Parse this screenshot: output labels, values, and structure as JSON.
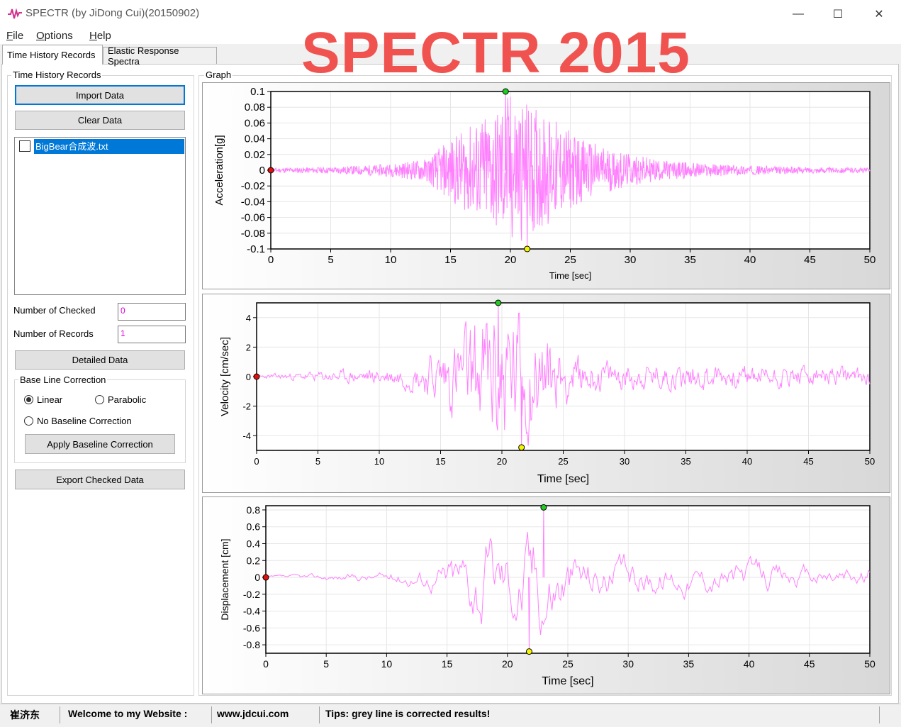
{
  "window": {
    "title": "SPECTR (by JiDong Cui)(20150902)",
    "overlay_title": "SPECTR 2015",
    "minimize_label": "—",
    "maximize_label": "☐",
    "close_label": "✕"
  },
  "menu": [
    {
      "accel": "F",
      "rest": "ile"
    },
    {
      "accel": "O",
      "rest": "ptions"
    },
    {
      "accel": "H",
      "rest": "elp"
    }
  ],
  "tabs": [
    {
      "label": "Time History Records",
      "active": true
    },
    {
      "label": "Elastic Response Spectra",
      "active": false
    }
  ],
  "left_panel": {
    "group_title": "Time History Records",
    "import_button": "Import Data",
    "clear_button": "Clear Data",
    "records": [
      {
        "name": "BigBear合成波.txt",
        "checked": false,
        "selected": true
      }
    ],
    "checked_label": "Number of Checked",
    "checked_value": "0",
    "records_label": "Number of Records",
    "records_value": "1",
    "detailed_button": "Detailed Data",
    "baseline": {
      "group_title": "Base Line Correction",
      "linear_label": "Linear",
      "parabolic_label": "Parabolic",
      "none_label": "No Baseline Correction",
      "selected": "linear",
      "apply_button": "Apply Baseline Correction"
    },
    "export_button": "Export Checked Data"
  },
  "graph_group_title": "Graph",
  "status": {
    "author": "崔济东",
    "welcome": "Welcome to my Website :",
    "website": "www.jdcui.com",
    "tips": "Tips: grey line is corrected results!"
  },
  "colors": {
    "trace": "#ff80ff",
    "max_marker": "#22cc22",
    "min_marker": "#f5f500",
    "start_marker": "#e01010",
    "tick_label": "#000000",
    "number_text": "#e000e0"
  },
  "chart_data": [
    {
      "type": "line",
      "title": "",
      "xlabel": "Time [sec]",
      "ylabel": "Acceleration[g]",
      "xlim": [
        0,
        50
      ],
      "ylim": [
        -0.1,
        0.1
      ],
      "xticks": [
        0,
        5,
        10,
        15,
        20,
        25,
        30,
        35,
        40,
        45,
        50
      ],
      "yticks": [
        "0.1",
        "0.08",
        "0.06",
        "0.04",
        "0.02",
        "0",
        "-0.02",
        "-0.04",
        "-0.06",
        "-0.08",
        "-0.1"
      ],
      "grid": true,
      "envelope": [
        [
          0,
          0.003
        ],
        [
          5,
          0.004
        ],
        [
          10,
          0.008
        ],
        [
          13,
          0.015
        ],
        [
          15,
          0.04
        ],
        [
          17,
          0.06
        ],
        [
          19,
          0.08
        ],
        [
          20,
          0.1
        ],
        [
          21,
          0.09
        ],
        [
          23,
          0.07
        ],
        [
          24,
          0.06
        ],
        [
          26,
          0.04
        ],
        [
          28,
          0.03
        ],
        [
          30,
          0.02
        ],
        [
          33,
          0.012
        ],
        [
          38,
          0.007
        ],
        [
          44,
          0.004
        ],
        [
          50,
          0.003
        ]
      ],
      "markers": {
        "start": [
          0,
          0
        ],
        "max": [
          19.6,
          0.1
        ],
        "min": [
          21.4,
          -0.1
        ]
      }
    },
    {
      "type": "line",
      "title": "",
      "xlabel": "Time [sec]",
      "ylabel": "Velocity [cm/sec]",
      "xlim": [
        0,
        50
      ],
      "ylim": [
        -5,
        5
      ],
      "xticks": [
        0,
        5,
        10,
        15,
        20,
        25,
        30,
        35,
        40,
        45,
        50
      ],
      "yticks": [
        "4",
        "2",
        "0",
        "-2",
        "-4"
      ],
      "grid": true,
      "envelope": [
        [
          0,
          0.1
        ],
        [
          5,
          0.3
        ],
        [
          10,
          0.5
        ],
        [
          13,
          0.8
        ],
        [
          15,
          1.8
        ],
        [
          17,
          3.0
        ],
        [
          18.5,
          4.0
        ],
        [
          19.7,
          5.0
        ],
        [
          21,
          4.5
        ],
        [
          22.5,
          3.5
        ],
        [
          24,
          2.2
        ],
        [
          26,
          1.2
        ],
        [
          30,
          0.8
        ],
        [
          35,
          0.8
        ],
        [
          40,
          0.7
        ],
        [
          45,
          0.6
        ],
        [
          50,
          0.5
        ]
      ],
      "markers": {
        "start": [
          0,
          0
        ],
        "max": [
          19.7,
          5
        ],
        "min": [
          21.6,
          -4.8
        ]
      }
    },
    {
      "type": "line",
      "title": "",
      "xlabel": "Time [sec]",
      "ylabel": "Displacement [cm]",
      "xlim": [
        0,
        50
      ],
      "ylim": [
        -0.9,
        0.85
      ],
      "xticks": [
        0,
        5,
        10,
        15,
        20,
        25,
        30,
        35,
        40,
        45,
        50
      ],
      "yticks": [
        "0.8",
        "0.6",
        "0.4",
        "0.2",
        "0",
        "-0.2",
        "-0.4",
        "-0.6",
        "-0.8"
      ],
      "grid": true,
      "envelope": [
        [
          0,
          0.02
        ],
        [
          5,
          0.05
        ],
        [
          10,
          0.08
        ],
        [
          14,
          0.2
        ],
        [
          16,
          0.45
        ],
        [
          18,
          0.75
        ],
        [
          20,
          0.6
        ],
        [
          21.8,
          0.9
        ],
        [
          23,
          0.8
        ],
        [
          25,
          0.45
        ],
        [
          28,
          0.3
        ],
        [
          32,
          0.25
        ],
        [
          36,
          0.2
        ],
        [
          40,
          0.25
        ],
        [
          45,
          0.15
        ],
        [
          50,
          0.2
        ]
      ],
      "markers": {
        "start": [
          0,
          0
        ],
        "max": [
          23.0,
          0.83
        ],
        "min": [
          21.8,
          -0.88
        ]
      }
    }
  ]
}
